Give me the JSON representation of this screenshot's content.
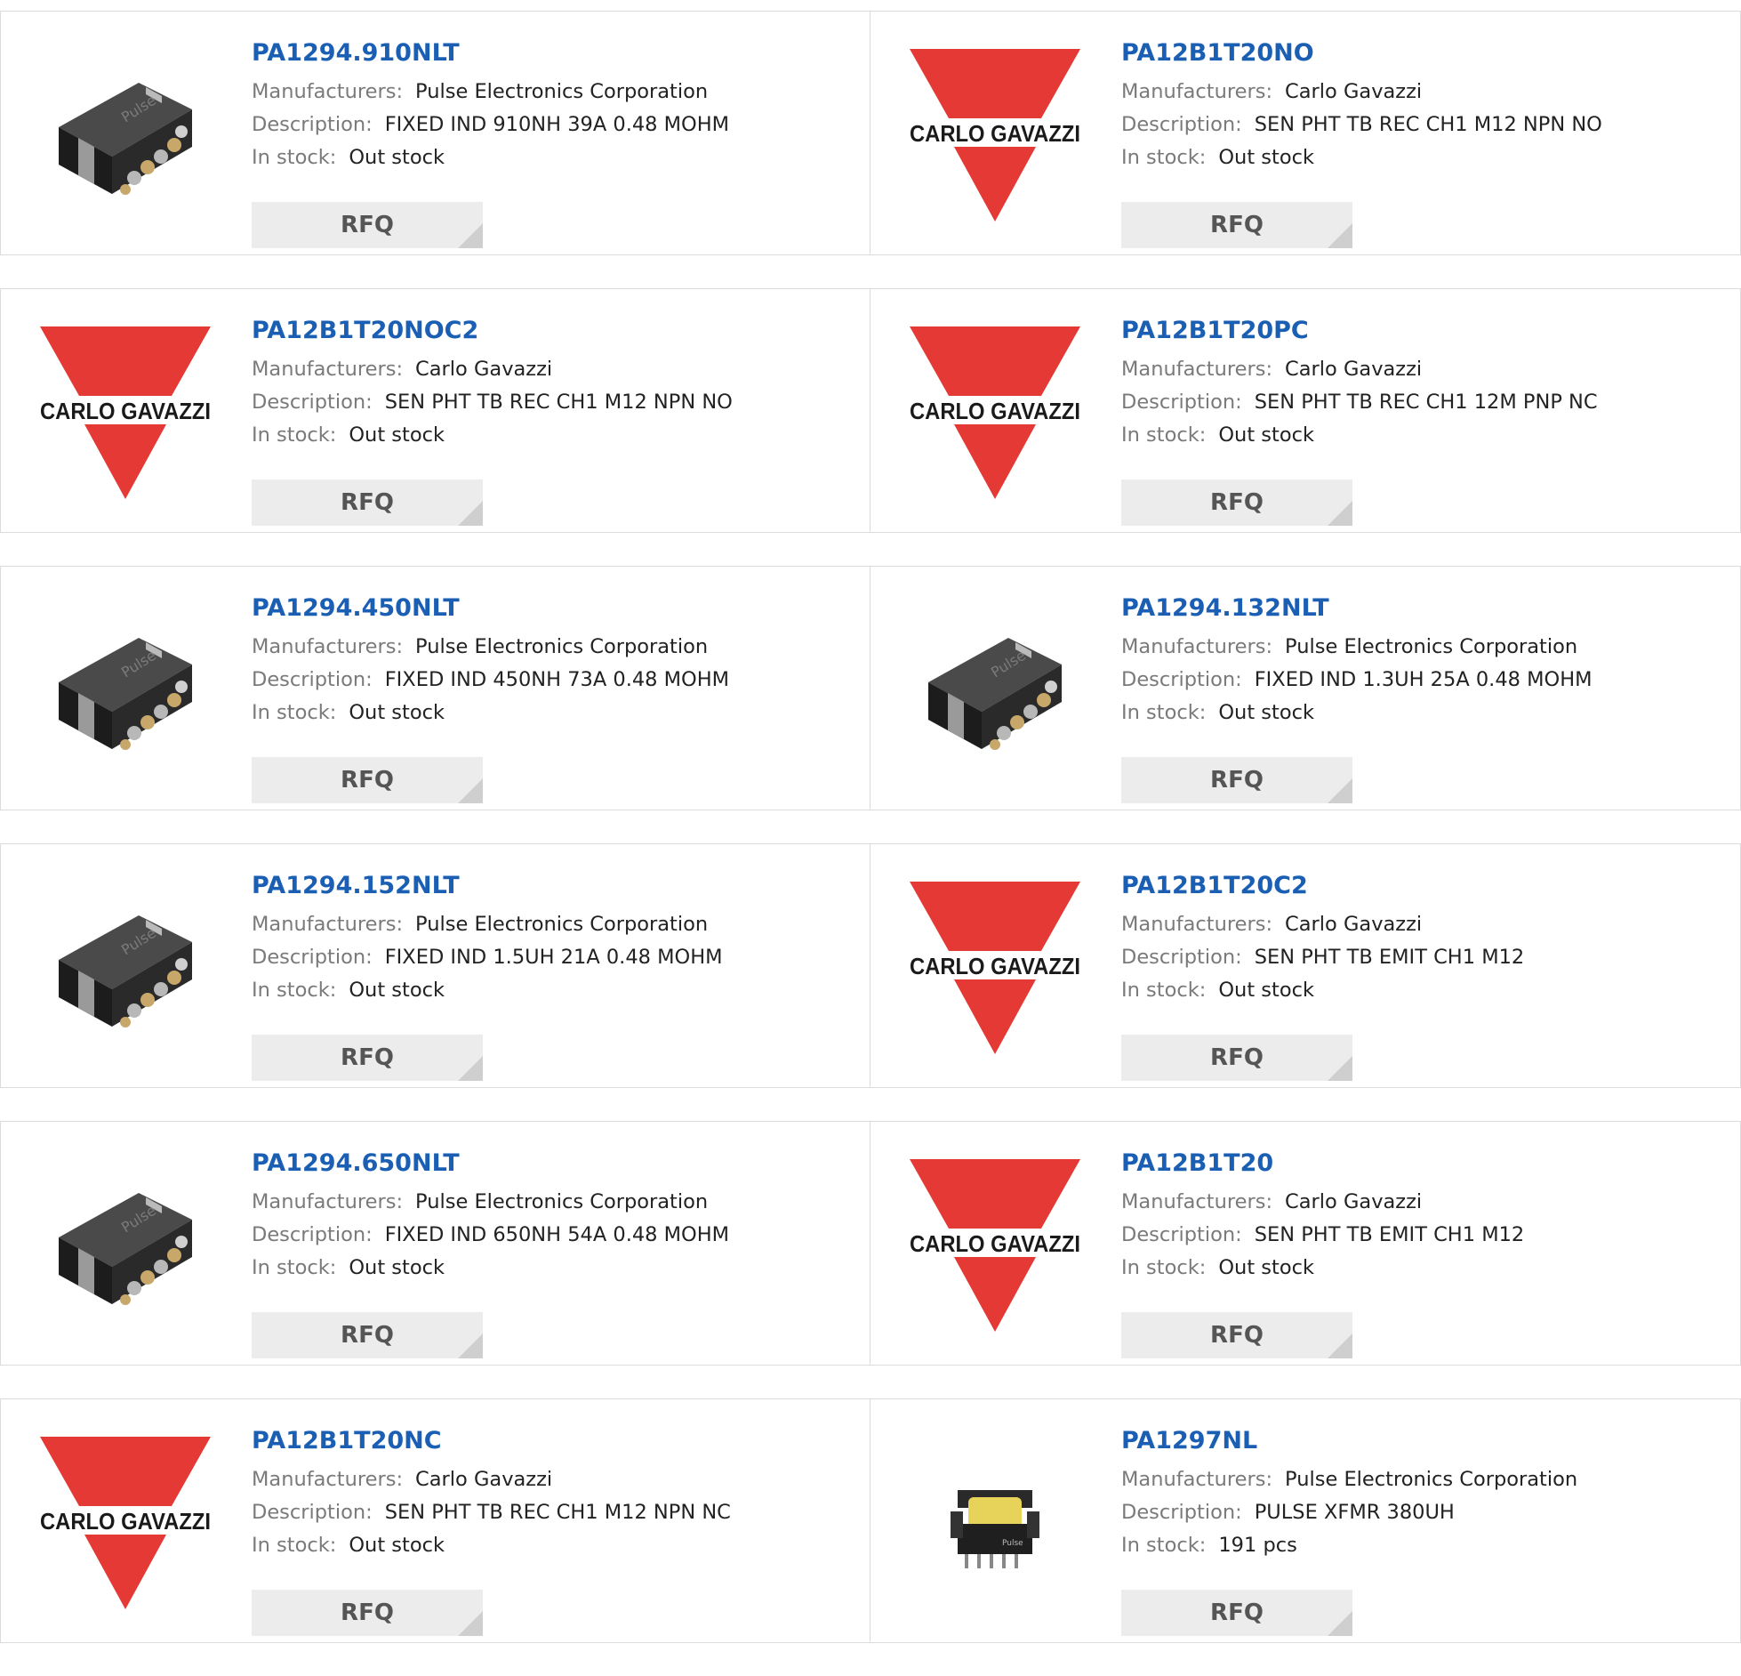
{
  "labels": {
    "manufacturers": "Manufacturers:",
    "description": "Description:",
    "in_stock": "In stock:",
    "rfq": "RFQ"
  },
  "colors": {
    "part_link": "#1a5fb4",
    "carlo_red": "#e53935",
    "button_bg": "#ececec"
  },
  "products": [
    {
      "part": "PA1294.910NLT",
      "manufacturer": "Pulse Electronics Corporation",
      "description": "FIXED IND 910NH 39A 0.48 MOHM",
      "stock": "Out stock",
      "image": "pulse-inductor-icon"
    },
    {
      "part": "PA12B1T20NO",
      "manufacturer": "Carlo Gavazzi",
      "description": "SEN PHT TB REC CH1 M12 NPN NO",
      "stock": "Out stock",
      "image": "carlo-gavazzi-logo",
      "logo_text": "CARLO GAVAZZI"
    },
    {
      "part": "PA12B1T20NOC2",
      "manufacturer": "Carlo Gavazzi",
      "description": "SEN PHT TB REC CH1 M12 NPN NO",
      "stock": "Out stock",
      "image": "carlo-gavazzi-logo",
      "logo_text": "CARLO GAVAZZI"
    },
    {
      "part": "PA12B1T20PC",
      "manufacturer": "Carlo Gavazzi",
      "description": "SEN PHT TB REC CH1 12M PNP NC",
      "stock": "Out stock",
      "image": "carlo-gavazzi-logo",
      "logo_text": "CARLO GAVAZZI"
    },
    {
      "part": "PA1294.450NLT",
      "manufacturer": "Pulse Electronics Corporation",
      "description": "FIXED IND 450NH 73A 0.48 MOHM",
      "stock": "Out stock",
      "image": "pulse-inductor-icon"
    },
    {
      "part": "PA1294.132NLT",
      "manufacturer": "Pulse Electronics Corporation",
      "description": "FIXED IND 1.3UH 25A 0.48 MOHM",
      "stock": "Out stock",
      "image": "pulse-inductor-icon"
    },
    {
      "part": "PA1294.152NLT",
      "manufacturer": "Pulse Electronics Corporation",
      "description": "FIXED IND 1.5UH 21A 0.48 MOHM",
      "stock": "Out stock",
      "image": "pulse-inductor-icon"
    },
    {
      "part": "PA12B1T20C2",
      "manufacturer": "Carlo Gavazzi",
      "description": "SEN PHT TB EMIT CH1 M12",
      "stock": "Out stock",
      "image": "carlo-gavazzi-logo",
      "logo_text": "CARLO GAVAZZI"
    },
    {
      "part": "PA1294.650NLT",
      "manufacturer": "Pulse Electronics Corporation",
      "description": "FIXED IND 650NH 54A 0.48 MOHM",
      "stock": "Out stock",
      "image": "pulse-inductor-icon"
    },
    {
      "part": "PA12B1T20",
      "manufacturer": "Carlo Gavazzi",
      "description": "SEN PHT TB EMIT CH1 M12",
      "stock": "Out stock",
      "image": "carlo-gavazzi-logo",
      "logo_text": "CARLO GAVAZZI"
    },
    {
      "part": "PA12B1T20NC",
      "manufacturer": "Carlo Gavazzi",
      "description": "SEN PHT TB REC CH1 M12 NPN NC",
      "stock": "Out stock",
      "image": "carlo-gavazzi-logo",
      "logo_text": "CARLO GAVAZZI"
    },
    {
      "part": "PA1297NL",
      "manufacturer": "Pulse Electronics Corporation",
      "description": "PULSE XFMR 380UH",
      "stock": "191 pcs",
      "image": "transformer-icon"
    }
  ]
}
